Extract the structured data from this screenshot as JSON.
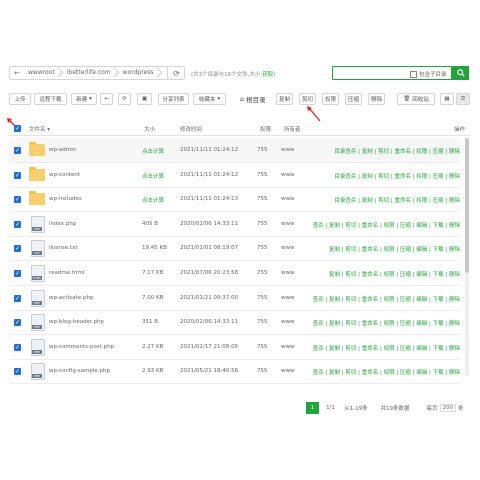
{
  "path": {
    "crumbs": [
      "wwwroot",
      "ibetterlife.com",
      "wordpress"
    ],
    "summary": "(共3个目录与16个文件,大小:",
    "summary_link": "获取",
    "summary_end": ")"
  },
  "search": {
    "value": "",
    "subdir_label": "包含子目录"
  },
  "toolbar": {
    "upload": "上传",
    "remote_download": "远程下载",
    "new": "新建",
    "share_list": "分享列表",
    "favorites": "收藏夹",
    "root_dir": "根目录",
    "copy": "复制",
    "cut": "剪切",
    "permission": "权限",
    "compress": "压缩",
    "delete": "删除",
    "recycle_bin": "回收站"
  },
  "table": {
    "headers": {
      "name": "文件名",
      "size": "大小",
      "mtime": "修改时间",
      "perm": "权限",
      "owner": "所有者",
      "ops": "操作"
    },
    "rows": [
      {
        "type": "folder",
        "name": "wp-admin",
        "size": "点击计算",
        "mtime": "2021/11/11 01:24:12",
        "perm": "755",
        "owner": "www",
        "actions": "目录查杀 | 复制 | 剪切 | 重命名 | 权限 | 压缩 | 删除"
      },
      {
        "type": "folder",
        "name": "wp-content",
        "size": "点击计算",
        "mtime": "2021/11/11 01:24:12",
        "perm": "755",
        "owner": "www",
        "actions": "目录查杀 | 复制 | 剪切 | 重命名 | 权限 | 压缩 | 删除"
      },
      {
        "type": "folder",
        "name": "wp-includes",
        "size": "点击计算",
        "mtime": "2021/11/11 01:24:13",
        "perm": "755",
        "owner": "www",
        "actions": "目录查杀 | 复制 | 剪切 | 重命名 | 权限 | 压缩 | 删除"
      },
      {
        "type": "file",
        "icon": "PHP",
        "name": "index.php",
        "size": "405 B",
        "mtime": "2020/02/06 14:33:11",
        "perm": "755",
        "owner": "www",
        "actions": "查杀 | 复制 | 剪切 | 重命名 | 权限 | 压缩 | 编辑 | 下载 | 删除"
      },
      {
        "type": "file",
        "icon": "TXT",
        "name": "license.txt",
        "size": "19.45 KB",
        "mtime": "2021/01/01 08:19:07",
        "perm": "755",
        "owner": "www",
        "actions": "复制 | 剪切 | 重命名 | 权限 | 压缩 | 编辑 | 下载 | 删除"
      },
      {
        "type": "file",
        "icon": "HTML",
        "name": "readme.html",
        "size": "7.17 KB",
        "mtime": "2021/07/06 20:23:58",
        "perm": "755",
        "owner": "www",
        "actions": "复制 | 剪切 | 重命名 | 权限 | 压缩 | 编辑 | 下载 | 删除"
      },
      {
        "type": "file",
        "icon": "PHP",
        "name": "wp-activate.php",
        "size": "7.00 KB",
        "mtime": "2021/01/21 09:37:00",
        "perm": "755",
        "owner": "www",
        "actions": "查杀 | 复制 | 剪切 | 重命名 | 权限 | 压缩 | 编辑 | 下载 | 删除"
      },
      {
        "type": "file",
        "icon": "PHP",
        "name": "wp-blog-header.php",
        "size": "351 B",
        "mtime": "2020/02/06 14:33:11",
        "perm": "755",
        "owner": "www",
        "actions": "查杀 | 复制 | 剪切 | 重命名 | 权限 | 压缩 | 编辑 | 下载 | 删除"
      },
      {
        "type": "file",
        "icon": "PHP",
        "name": "wp-comments-post.php",
        "size": "2.27 KB",
        "mtime": "2021/02/17 21:08:05",
        "perm": "755",
        "owner": "www",
        "actions": "查杀 | 复制 | 剪切 | 重命名 | 权限 | 压缩 | 编辑 | 下载 | 删除"
      },
      {
        "type": "file",
        "icon": "PHP",
        "name": "wp-config-sample.php",
        "size": "2.93 KB",
        "mtime": "2021/05/21 18:40:56",
        "perm": "755",
        "owner": "www",
        "actions": "查杀 | 复制 | 剪切 | 重命名 | 权限 | 压缩 | 编辑 | 下载 | 删除"
      }
    ]
  },
  "pagination": {
    "current": "1",
    "page_of": "1/1",
    "range": "从1-19条",
    "total": "共19条数据",
    "per_page": "每页",
    "per_page_value": "200",
    "unit": "条"
  },
  "colors": {
    "accent": "#20a53a",
    "checkbox": "#1e6fd9",
    "arrow": "#e02020"
  }
}
